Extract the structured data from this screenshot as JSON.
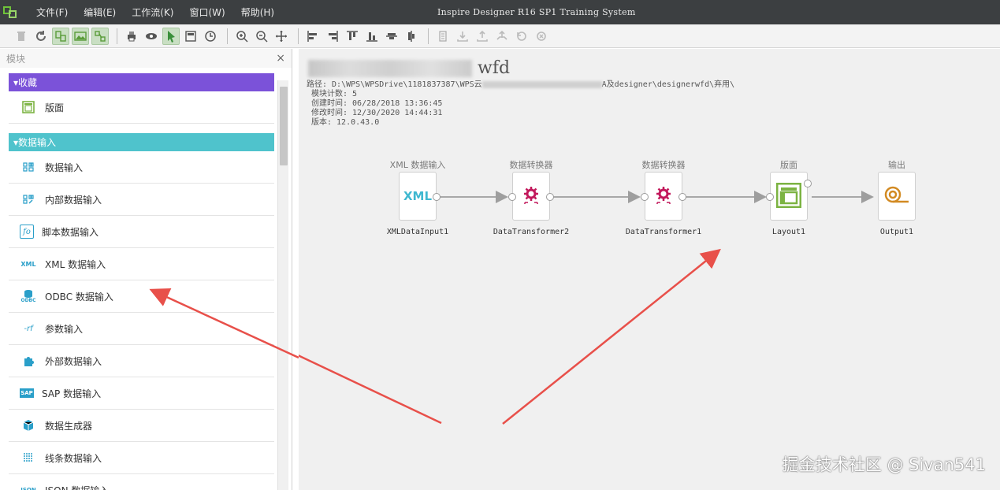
{
  "window": {
    "title": "Inspire Designer R16 SP1 Training System"
  },
  "menu": [
    "文件(F)",
    "编辑(E)",
    "工作流(K)",
    "窗口(W)",
    "帮助(H)"
  ],
  "panel": {
    "title": "模块",
    "close_label": "×",
    "favorites_label": "▾收藏",
    "favorites": [
      {
        "label": "版面",
        "icon": "layout-icon"
      }
    ],
    "data_input_label": "▾数据输入",
    "items": [
      {
        "label": "数据输入",
        "icon": "data-input-icon"
      },
      {
        "label": "内部数据输入",
        "icon": "internal-data-input-icon"
      },
      {
        "label": "脚本数据输入",
        "icon": "script-data-input-icon",
        "glyph": "fo"
      },
      {
        "label": "XML 数据输入",
        "icon": "xml-input-icon",
        "glyph": "XML"
      },
      {
        "label": "ODBC 数据输入",
        "icon": "odbc-input-icon",
        "glyph": "ODBC"
      },
      {
        "label": "参数输入",
        "icon": "parameter-input-icon",
        "glyph": "-rf"
      },
      {
        "label": "外部数据输入",
        "icon": "external-data-input-icon"
      },
      {
        "label": "SAP 数据输入",
        "icon": "sap-input-icon",
        "glyph": "SAP"
      },
      {
        "label": "数据生成器",
        "icon": "data-generator-icon"
      },
      {
        "label": "线条数据输入",
        "icon": "line-data-input-icon"
      },
      {
        "label": "JSON 数据输入",
        "icon": "json-input-icon",
        "glyph": "JSON"
      }
    ]
  },
  "workflow": {
    "title_suffix": "wfd",
    "path_prefix": "路径: D:\\WPS\\WPSDrive\\1181837387\\WPS云",
    "path_suffix": "A及designer\\designerwfd\\弃用\\",
    "module_count": "模块计数: 5",
    "created": "创建时间: 06/28/2018 13:36:45",
    "modified": "修改时间: 12/30/2020 14:44:31",
    "version": "版本: 12.0.43.0",
    "nodes": [
      {
        "type": "XML 数据输入",
        "name": "XMLDataInput1",
        "icon": "xml-icon",
        "icon_text": "XML"
      },
      {
        "type": "数据转换器",
        "name": "DataTransformer2",
        "icon": "transformer-gear-icon"
      },
      {
        "type": "数据转换器",
        "name": "DataTransformer1",
        "icon": "transformer-gear-icon"
      },
      {
        "type": "版面",
        "name": "Layout1",
        "icon": "layout-icon"
      },
      {
        "type": "输出",
        "name": "Output1",
        "icon": "output-roll-icon"
      }
    ]
  },
  "colors": {
    "favorites": "#7b52d9",
    "data_input": "#4fc3cc",
    "arrow": "#e8504a",
    "transformer": "#c2185b",
    "layout": "#7cb342",
    "output": "#d28a22"
  },
  "watermark": "掘金技术社区 @ Sivan541"
}
